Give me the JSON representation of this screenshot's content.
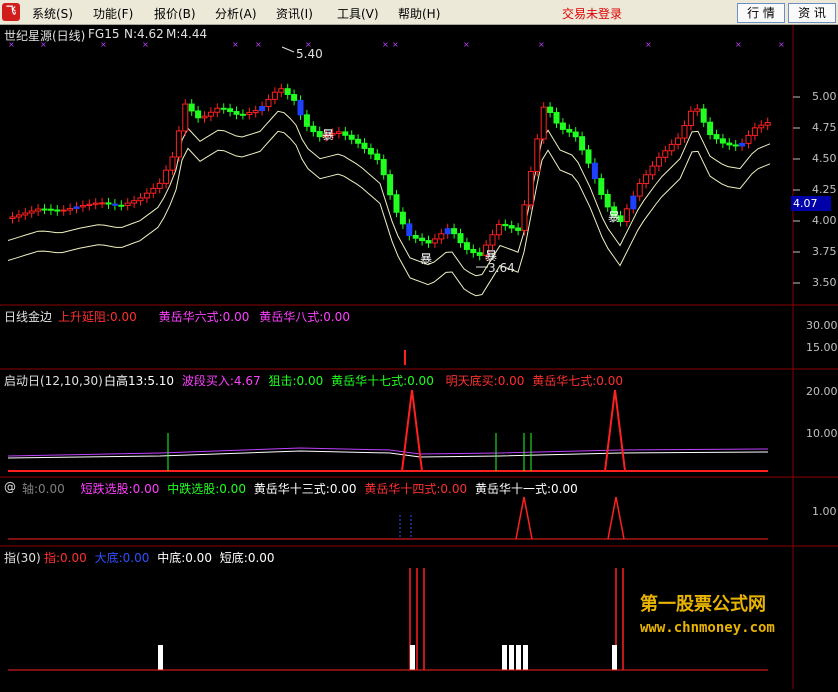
{
  "menu": {
    "logo": "飞",
    "items": [
      "系统(S)",
      "功能(F)",
      "报价(B)",
      "分析(A)",
      "资讯(I)",
      "工具(V)",
      "帮助(H)"
    ],
    "login_status": "交易未登录",
    "btn_quotes": "行 情",
    "btn_news": "资 讯"
  },
  "main_panel": {
    "title": "世纪星源(日线)",
    "indicator": "FG15",
    "n_value": "N:4.62",
    "m_value": "M:4.44",
    "high_label": "5.40",
    "low_label": "3.64",
    "tag": "暴",
    "current_price": "4.07",
    "y_ticks": [
      "5.00",
      "4.75",
      "4.50",
      "4.25",
      "4.00",
      "3.75",
      "3.50"
    ]
  },
  "panel2": {
    "name": "日线金边",
    "items": [
      {
        "text": "上升延阻:0.00",
        "color": "#ff3030"
      },
      {
        "text": "黄岳华六式:0.00",
        "color": "#ff40ff"
      },
      {
        "text": "黄岳华八式:0.00",
        "color": "#ff40ff"
      }
    ],
    "y_ticks": [
      "30.00",
      "15.00"
    ]
  },
  "panel3": {
    "name": "启动日(12,10,30)",
    "items": [
      {
        "text": "白高13:5.10",
        "color": "#ffffff"
      },
      {
        "text": "波段买入:4.67",
        "color": "#ff40ff"
      },
      {
        "text": "狙击:0.00",
        "color": "#20ff20"
      },
      {
        "text": "黄岳华十七式:0.00",
        "color": "#20ff20"
      },
      {
        "text": "明天底买:0.00",
        "color": "#ff3030"
      },
      {
        "text": "黄岳华七式:0.00",
        "color": "#ff3030"
      }
    ],
    "y_ticks": [
      "20.00",
      "10.00"
    ]
  },
  "panel4": {
    "name": "@",
    "items": [
      {
        "text": "轴:0.00",
        "color": "#808080"
      },
      {
        "text": "短跌选股:0.00",
        "color": "#ff40ff"
      },
      {
        "text": "中跌选股:0.00",
        "color": "#20ff20"
      },
      {
        "text": "黄岳华十三式:0.00",
        "color": "#ffffff"
      },
      {
        "text": "黄岳华十四式:0.00",
        "color": "#ff3030"
      },
      {
        "text": "黄岳华十一式:0.00",
        "color": "#ffffff"
      }
    ],
    "y_ticks": [
      "1.00"
    ]
  },
  "panel5": {
    "name": "指(30)",
    "items": [
      {
        "text": "指:0.00",
        "color": "#ff3030"
      },
      {
        "text": "大底:0.00",
        "color": "#3050ff"
      },
      {
        "text": "中底:0.00",
        "color": "#ffffff"
      },
      {
        "text": "短底:0.00",
        "color": "#ffffff"
      }
    ]
  },
  "watermark": {
    "cn": "第一股票公式网",
    "url": "www.chnmoney.com"
  },
  "colors": {
    "up": "#ff2020",
    "down": "#20ff20",
    "accent_blue": "#2040ff",
    "envelope": "#f0f0c0",
    "divider": "#8b0000"
  }
}
